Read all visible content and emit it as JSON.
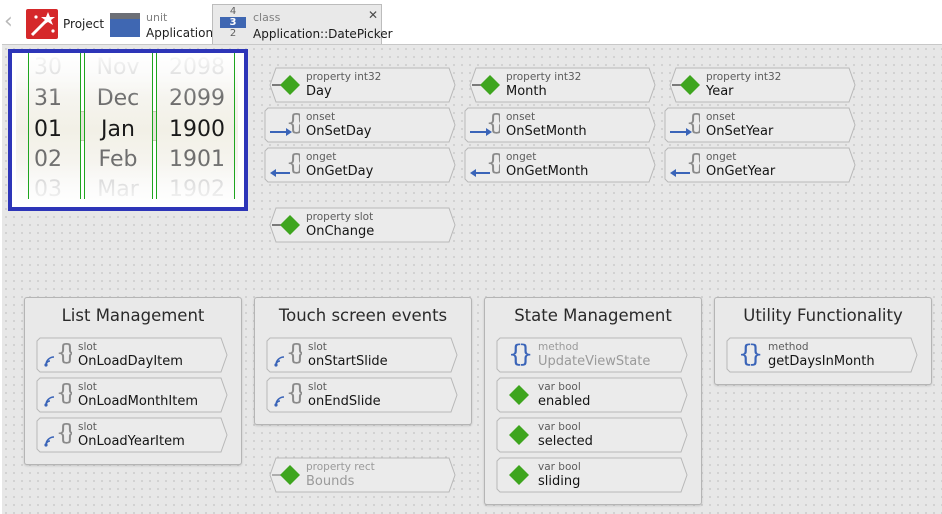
{
  "tabs": {
    "project": {
      "label": "Project"
    },
    "unit": {
      "kind": "unit",
      "name": "Application"
    },
    "class": {
      "kind": "class",
      "name": "Application::DatePicker",
      "stack": [
        "4",
        "3",
        "2"
      ],
      "close": "✕"
    }
  },
  "preview": {
    "days": [
      "30",
      "31",
      "01",
      "02",
      "03"
    ],
    "months": [
      "Nov",
      "Dec",
      "Jan",
      "Feb",
      "Mar"
    ],
    "years": [
      "2098",
      "2099",
      "1900",
      "1901",
      "1902"
    ],
    "selected_index": 2
  },
  "members": {
    "day": {
      "kind": "property int32",
      "name": "Day"
    },
    "onsetday": {
      "kind": "onset",
      "name": "OnSetDay"
    },
    "ongetday": {
      "kind": "onget",
      "name": "OnGetDay"
    },
    "month": {
      "kind": "property int32",
      "name": "Month"
    },
    "onsetmonth": {
      "kind": "onset",
      "name": "OnSetMonth"
    },
    "ongetmonth": {
      "kind": "onget",
      "name": "OnGetMonth"
    },
    "year": {
      "kind": "property int32",
      "name": "Year"
    },
    "onsetyear": {
      "kind": "onset",
      "name": "OnSetYear"
    },
    "ongetyear": {
      "kind": "onget",
      "name": "OnGetYear"
    },
    "onchange": {
      "kind": "property slot",
      "name": "OnChange"
    },
    "bounds": {
      "kind": "property rect",
      "name": "Bounds"
    }
  },
  "bricks": {
    "list": {
      "title": "List Management",
      "items": [
        {
          "kind": "slot",
          "name": "OnLoadDayItem"
        },
        {
          "kind": "slot",
          "name": "OnLoadMonthItem"
        },
        {
          "kind": "slot",
          "name": "OnLoadYearItem"
        }
      ]
    },
    "touch": {
      "title": "Touch screen events",
      "items": [
        {
          "kind": "slot",
          "name": "onStartSlide"
        },
        {
          "kind": "slot",
          "name": "onEndSlide"
        }
      ]
    },
    "state": {
      "title": "State Management",
      "items": [
        {
          "kind": "method",
          "name": "UpdateViewState"
        },
        {
          "kind": "var bool",
          "name": "enabled"
        },
        {
          "kind": "var bool",
          "name": "selected"
        },
        {
          "kind": "var bool",
          "name": "sliding"
        }
      ]
    },
    "utility": {
      "title": "Utility Functionality",
      "items": [
        {
          "kind": "method",
          "name": "getDaysInMonth"
        }
      ]
    }
  },
  "colors": {
    "diamond": "#3ea51e",
    "arrow": "#3a64b8",
    "brace_blue": "#3a64b8",
    "brace_gray": "#8a8a8a",
    "preview_border": "#2d35b8",
    "wheel_line": "#1ea51e"
  }
}
